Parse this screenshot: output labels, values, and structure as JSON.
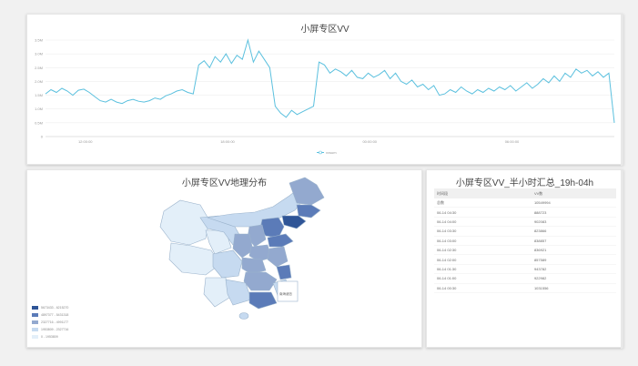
{
  "top_chart": {
    "title": "小屏专区VV",
    "y_ticks": [
      "3.5M",
      "3.0M",
      "2.5M",
      "2.0M",
      "1.5M",
      "1.0M",
      "0.5M",
      "0"
    ],
    "x_ticks": [
      "12:00:00",
      "18:00:00",
      "00:00:00",
      "06:00:00"
    ],
    "legend": "vvsum",
    "line_color": "#5bc0de"
  },
  "chart_data": {
    "type": "line",
    "title": "小屏专区VV",
    "ylim": [
      0,
      3500000
    ],
    "y_ticks": [
      0,
      500000,
      1000000,
      1500000,
      2000000,
      2500000,
      3000000,
      3500000
    ],
    "series": [
      {
        "name": "vvsum",
        "values": [
          1550000,
          1700000,
          1600000,
          1750000,
          1650000,
          1500000,
          1680000,
          1720000,
          1600000,
          1450000,
          1300000,
          1250000,
          1350000,
          1250000,
          1200000,
          1300000,
          1350000,
          1280000,
          1250000,
          1300000,
          1400000,
          1350000,
          1480000,
          1550000,
          1650000,
          1700000,
          1600000,
          1550000,
          2600000,
          2750000,
          2500000,
          2900000,
          2700000,
          3000000,
          2650000,
          2950000,
          2800000,
          3500000,
          2700000,
          3100000,
          2800000,
          2500000,
          1100000,
          850000,
          700000,
          950000,
          800000,
          900000,
          1000000,
          1100000,
          2700000,
          2600000,
          2300000,
          2450000,
          2350000,
          2200000,
          2400000,
          2150000,
          2100000,
          2300000,
          2150000,
          2250000,
          2400000,
          2100000,
          2300000,
          2000000,
          1900000,
          2050000,
          1800000,
          1900000,
          1700000,
          1850000,
          1500000,
          1550000,
          1700000,
          1600000,
          1800000,
          1650000,
          1550000,
          1700000,
          1600000,
          1750000,
          1650000,
          1800000,
          1700000,
          1850000,
          1650000,
          1800000,
          1950000,
          1750000,
          1900000,
          2100000,
          1950000,
          2200000,
          2000000,
          2300000,
          2150000,
          2450000,
          2300000,
          2400000,
          2200000,
          2350000,
          2150000,
          2300000,
          500000
        ]
      }
    ]
  },
  "map": {
    "title": "小屏专区VV地理分布",
    "inset_label": "南海诸岛",
    "legend": [
      {
        "label": "5673433 - 6215270",
        "color": "#2f5597"
      },
      {
        "label": "4897377 - 5431318",
        "color": "#5b7bb8"
      },
      {
        "label": "2327716 - 4991177",
        "color": "#93a9cf"
      },
      {
        "label": "1953809 - 2327716",
        "color": "#c6daf0"
      },
      {
        "label": "0 - 1953809",
        "color": "#e3eff9"
      }
    ]
  },
  "table": {
    "title": "小屏专区VV_半小时汇总_19h-04h",
    "headers": [
      "时间段",
      "VV数"
    ],
    "rows": [
      [
        "总数",
        "10549994"
      ],
      [
        "06-14 04:30",
        "888723"
      ],
      [
        "06-14 04:00",
        "902083"
      ],
      [
        "06-14 03:30",
        "823866"
      ],
      [
        "06-14 03:00",
        "838857"
      ],
      [
        "06-14 02:30",
        "836921"
      ],
      [
        "06-14 02:00",
        "857589"
      ],
      [
        "06-14 01:30",
        "943782"
      ],
      [
        "06-14 01:00",
        "922982"
      ],
      [
        "06-14 00:30",
        "1031556"
      ]
    ]
  }
}
